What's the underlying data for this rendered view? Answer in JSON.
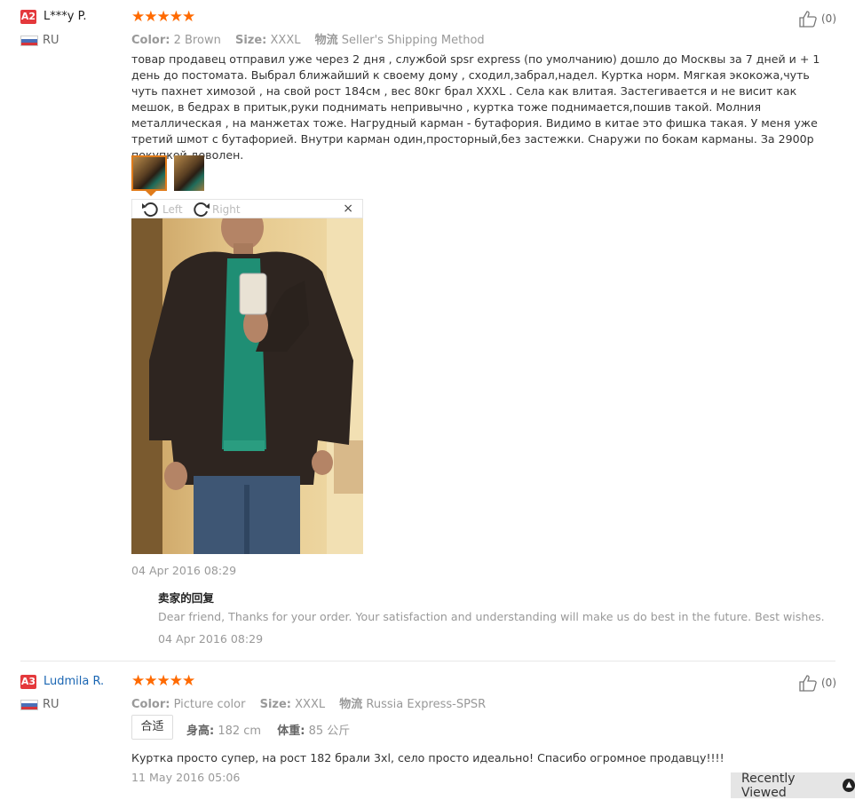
{
  "reviews": [
    {
      "level": "A2",
      "user": "L***y P.",
      "country": "RU",
      "stars": "★★★★★",
      "likes": "(0)",
      "attrs": {
        "color_label": "Color:",
        "color_value": "2 Brown",
        "size_label": "Size:",
        "size_value": "XXXL",
        "ship_label": "物流",
        "ship_value": "Seller's Shipping Method"
      },
      "text": "товар продавец отправил уже через 2 дня , службой spsr express (по умолчанию) дошло до Москвы за 7 дней и + 1 день до постомата. Выбрал ближайший к своему дому , сходил,забрал,надел. Куртка норм. Мягкая экокожа,чуть чуть пахнет химозой , на свой рост 184см , вес 80кг брал XXXL . Села как влитая. Застегивается и не висит как мешок, в бедрах в притык,руки поднимать непривычно , куртка тоже поднимается,пошив такой. Молния металлическая , на манжетах тоже. Нагрудный карман - бутафория. Видимо в китае это фишка такая. У меня уже третий шмот с бутафорией. Внутри карман один,просторный,без застежки. Снаружи по бокам карманы. За 2900р покупкой доволен.",
      "viewer": {
        "left": "Left",
        "right": "Right",
        "close": "×"
      },
      "date": "04 Apr 2016 08:29",
      "reply": {
        "title": "卖家的回复",
        "text": "Dear friend, Thanks for your order. Your satisfaction and understanding will make us do best in the future. Best wishes.",
        "date": "04 Apr 2016 08:29"
      }
    },
    {
      "level": "A3",
      "user": "Ludmila R.",
      "country": "RU",
      "stars": "★★★★★",
      "likes": "(0)",
      "attrs": {
        "color_label": "Color:",
        "color_value": "Picture color",
        "size_label": "Size:",
        "size_value": "XXXL",
        "ship_label": "物流",
        "ship_value": "Russia Express-SPSR"
      },
      "fit": "合适",
      "height_label": "身高:",
      "height_value": "182 cm",
      "weight_label": "体重:",
      "weight_value": "85 公斤",
      "text": "Куртка просто супер, на рост 182 брали 3xl, село просто идеально! Спасибо огромное продавцу!!!!",
      "date": "11 May 2016 05:06"
    }
  ],
  "recently_viewed": "Recently Viewed",
  "colors": {
    "star": "#ff6a00",
    "badge": "#e4393c",
    "link": "#1a66b3",
    "thumb_active": "#e07b1a"
  },
  "icons": [
    "thumbs-up-icon",
    "rotate-left-icon",
    "rotate-right-icon",
    "close-icon",
    "chevron-up-icon",
    "russia-flag-icon"
  ]
}
